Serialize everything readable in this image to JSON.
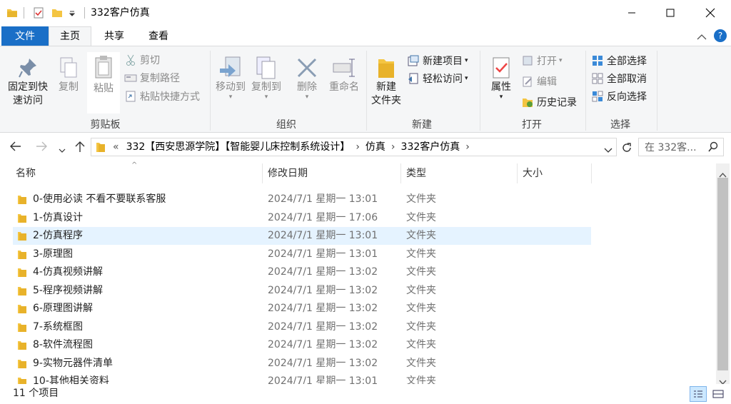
{
  "window": {
    "title": "332客户仿真"
  },
  "tabs": {
    "file": "文件",
    "home": "主页",
    "share": "共享",
    "view": "查看"
  },
  "ribbon": {
    "clipboard": {
      "label": "剪贴板",
      "pin_line1": "固定到快",
      "pin_line2": "速访问",
      "copy": "复制",
      "paste": "粘贴",
      "cut": "剪切",
      "copy_path": "复制路径",
      "paste_shortcut": "粘贴快捷方式"
    },
    "organize": {
      "label": "组织",
      "move_to": "移动到",
      "copy_to": "复制到",
      "delete": "删除",
      "rename": "重命名"
    },
    "new": {
      "label": "新建",
      "new_folder_line1": "新建",
      "new_folder_line2": "文件夹",
      "new_item": "新建项目",
      "easy_access": "轻松访问"
    },
    "open": {
      "label": "打开",
      "properties": "属性",
      "open": "打开",
      "edit": "编辑",
      "history": "历史记录"
    },
    "select": {
      "label": "选择",
      "select_all": "全部选择",
      "select_none": "全部取消",
      "invert": "反向选择"
    }
  },
  "address": {
    "overflow": "«",
    "crumbs": [
      "332【西安思源学院】【智能婴儿床控制系统设计】",
      "仿真",
      "332客户仿真"
    ],
    "search_placeholder": "在 332客..."
  },
  "columns": {
    "name": "名称",
    "date": "修改日期",
    "type": "类型",
    "size": "大小"
  },
  "files": [
    {
      "name": "0-使用必读  不看不要联系客服",
      "date": "2024/7/1 星期一 13:01",
      "type": "文件夹"
    },
    {
      "name": "1-仿真设计",
      "date": "2024/7/1 星期一 17:06",
      "type": "文件夹"
    },
    {
      "name": "2-仿真程序",
      "date": "2024/7/1 星期一 13:01",
      "type": "文件夹"
    },
    {
      "name": "3-原理图",
      "date": "2024/7/1 星期一 13:01",
      "type": "文件夹"
    },
    {
      "name": "4-仿真视频讲解",
      "date": "2024/7/1 星期一 13:02",
      "type": "文件夹"
    },
    {
      "name": "5-程序视频讲解",
      "date": "2024/7/1 星期一 13:02",
      "type": "文件夹"
    },
    {
      "name": "6-原理图讲解",
      "date": "2024/7/1 星期一 13:02",
      "type": "文件夹"
    },
    {
      "name": "7-系统框图",
      "date": "2024/7/1 星期一 13:02",
      "type": "文件夹"
    },
    {
      "name": "8-软件流程图",
      "date": "2024/7/1 星期一 13:02",
      "type": "文件夹"
    },
    {
      "name": "9-实物元器件清单",
      "date": "2024/7/1 星期一 13:02",
      "type": "文件夹"
    },
    {
      "name": "10-其他相关资料",
      "date": "2024/7/1 星期一 13:01",
      "type": "文件夹"
    }
  ],
  "status": {
    "item_count": "11 个项目"
  },
  "colors": {
    "accent": "#1a6fc7",
    "selection": "#e5f3ff",
    "folder": "#f4c542"
  }
}
